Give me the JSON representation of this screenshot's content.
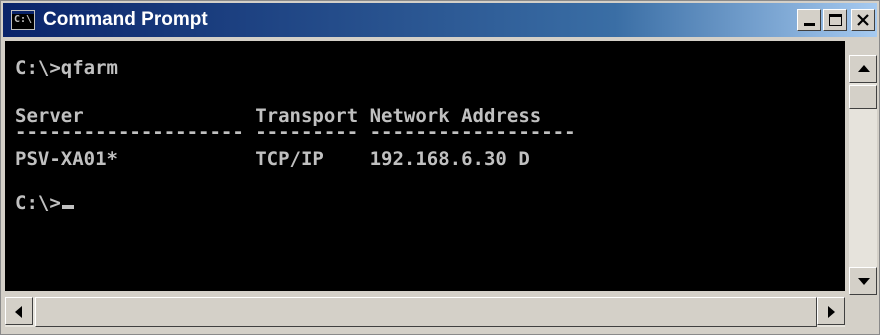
{
  "window": {
    "title": "Command Prompt",
    "icon": "console-icon",
    "icon_text": "C:\\",
    "controls": [
      "minimize",
      "maximize",
      "close"
    ]
  },
  "console": {
    "lines": [
      "C:\\>qfarm",
      "Server               Transport Network Address",
      "-------------------- --------- ------------------",
      "PSV-XA01*            TCP/IP    192.168.6.30 D",
      "C:\\>"
    ],
    "foreground": "#c0c0c0",
    "background": "#000000"
  },
  "colors": {
    "title_bar_start": "#0a246a",
    "title_bar_end": "#a6caf0",
    "chrome": "#d4d0c8"
  }
}
